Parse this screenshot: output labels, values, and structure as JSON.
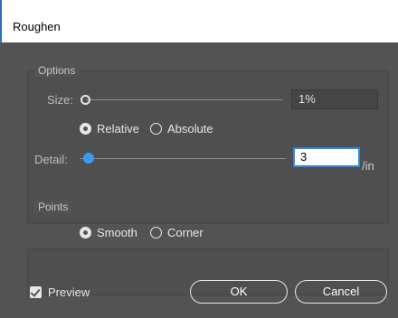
{
  "window": {
    "title": "Roughen"
  },
  "options": {
    "group_label": "Options",
    "size": {
      "label": "Size:",
      "value": "1%"
    },
    "size_mode": {
      "relative_label": "Relative",
      "absolute_label": "Absolute",
      "selected": "Relative"
    },
    "detail": {
      "label": "Detail:",
      "value": "3",
      "unit": "/in"
    }
  },
  "points": {
    "group_label": "Points",
    "smooth_label": "Smooth",
    "corner_label": "Corner",
    "selected": "Smooth"
  },
  "footer": {
    "preview_label": "Preview",
    "preview_checked": true,
    "ok_label": "OK",
    "cancel_label": "Cancel"
  },
  "colors": {
    "dialog_bg": "#535353",
    "accent": "#2f86e6",
    "slider_thumb_active": "#3b9bf2"
  },
  "icons": [
    "checkmark-icon"
  ]
}
